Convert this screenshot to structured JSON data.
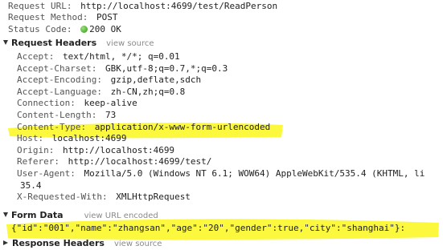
{
  "general": {
    "request_url_key": "Request URL:",
    "request_url_value": "http://localhost:4699/test/ReadPerson",
    "request_method_key": "Request Method:",
    "request_method_value": "POST",
    "status_code_key": "Status Code:",
    "status_code_value": "200 OK",
    "status_color": "#2c9a17"
  },
  "request_headers": {
    "title": "Request Headers",
    "view_source_label": "view source",
    "headers": [
      {
        "key": "Accept:",
        "value": "text/html, */*; q=0.01"
      },
      {
        "key": "Accept-Charset:",
        "value": "GBK,utf-8;q=0.7,*;q=0.3"
      },
      {
        "key": "Accept-Encoding:",
        "value": "gzip,deflate,sdch"
      },
      {
        "key": "Accept-Language:",
        "value": "zh-CN,zh;q=0.8"
      },
      {
        "key": "Connection:",
        "value": "keep-alive"
      },
      {
        "key": "Content-Length:",
        "value": "73"
      },
      {
        "key": "Content-Type:",
        "value": "application/x-www-form-urlencoded"
      },
      {
        "key": "Host:",
        "value": "localhost:4699"
      },
      {
        "key": "Origin:",
        "value": "http://localhost:4699"
      },
      {
        "key": "Referer:",
        "value": "http://localhost:4699/test/"
      },
      {
        "key": "User-Agent:",
        "value": "Mozilla/5.0 (Windows NT 6.1; WOW64) AppleWebKit/535.4 (KHTML, li"
      },
      {
        "key": "",
        "value": "35.4"
      },
      {
        "key": "X-Requested-With:",
        "value": "XMLHttpRequest"
      }
    ]
  },
  "form_data": {
    "title": "Form Data",
    "view_url_encoded_label": "view URL encoded",
    "value": "{\"id\":\"001\",\"name\":\"zhangsan\",\"age\":\"20\",\"gender\":true,\"city\":\"shanghai\"}:"
  },
  "response_headers": {
    "title": "Response Headers",
    "view_source_label": "view source"
  },
  "highlight_color": "#fbf83d"
}
